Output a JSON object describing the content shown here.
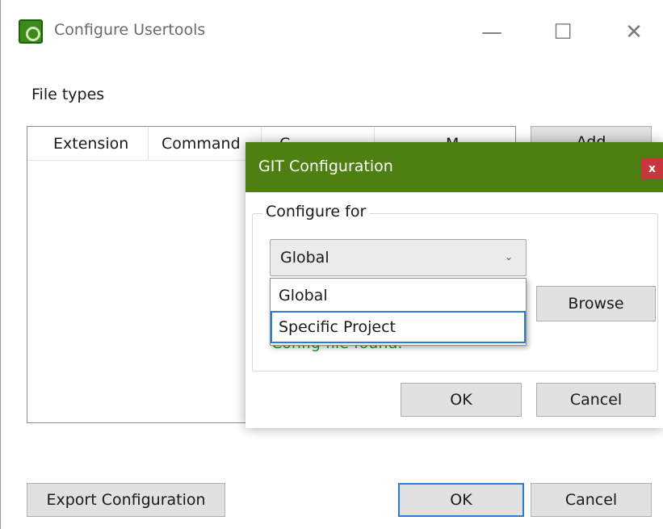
{
  "window": {
    "title": "Configure Usertools",
    "minimize_glyph": "—",
    "maximize_glyph": "☐",
    "close_glyph": "✕"
  },
  "main": {
    "section_label": "File types",
    "list": {
      "columns": [
        "Extension",
        "Command",
        "C",
        "M"
      ]
    },
    "add_button": "Add",
    "export_button": "Export Configuration",
    "ok_button": "OK",
    "cancel_button": "Cancel"
  },
  "dialog": {
    "title": "GIT Configuration",
    "close_glyph": "x",
    "group_label": "Configure for",
    "select": {
      "value": "Global",
      "options": [
        "Global",
        "Specific Project"
      ]
    },
    "browse_button": "Browse",
    "status_text": "Config file found.",
    "ok_button": "OK",
    "cancel_button": "Cancel"
  },
  "colors": {
    "dialog_titlebar": "#4d7f12",
    "close_button": "#c7373d",
    "focus_border": "#2b7cd6",
    "status_text": "#2e9a2e"
  }
}
